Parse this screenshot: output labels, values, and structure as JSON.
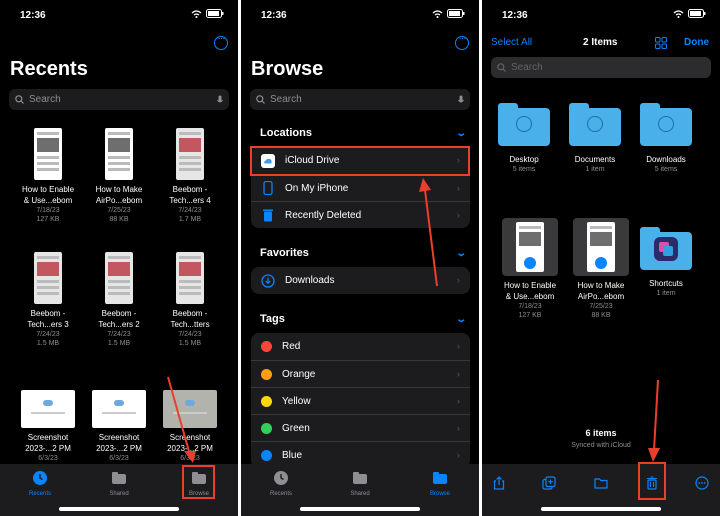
{
  "colors": {
    "accent": "#0a84ff",
    "annotation": "#e8402a",
    "background": "#000000",
    "cell": "#1c1c1e"
  },
  "status": {
    "time": "12:36"
  },
  "recents": {
    "title": "Recents",
    "search_placeholder": "Search",
    "items": [
      {
        "name1": "How to Enable",
        "name2": "& Use...ebom",
        "date": "7/18/23",
        "size": "127 KB"
      },
      {
        "name1": "How to Make",
        "name2": "AirPo...ebom",
        "date": "7/25/23",
        "size": "88 KB"
      },
      {
        "name1": "Beebom -",
        "name2": "Tech...ers 4",
        "date": "7/24/23",
        "size": "1.7 MB"
      },
      {
        "name1": "Beebom -",
        "name2": "Tech...ers 3",
        "date": "7/24/23",
        "size": "1.5 MB"
      },
      {
        "name1": "Beebom -",
        "name2": "Tech...ers 2",
        "date": "7/24/23",
        "size": "1.5 MB"
      },
      {
        "name1": "Beebom -",
        "name2": "Tech...tters",
        "date": "7/24/23",
        "size": "1.5 MB"
      },
      {
        "name1": "Screenshot",
        "name2": "2023-...2 PM",
        "date": "6/3/23",
        "size": ""
      },
      {
        "name1": "Screenshot",
        "name2": "2023-...2 PM",
        "date": "6/3/23",
        "size": ""
      },
      {
        "name1": "Screenshot",
        "name2": "2023-...2 PM",
        "date": "6/3/23",
        "size": ""
      }
    ],
    "tabs": [
      {
        "label": "Recents"
      },
      {
        "label": "Shared"
      },
      {
        "label": "Browse"
      }
    ]
  },
  "browse": {
    "title": "Browse",
    "search_placeholder": "Search",
    "locations_header": "Locations",
    "locations": [
      {
        "label": "iCloud Drive"
      },
      {
        "label": "On My iPhone"
      },
      {
        "label": "Recently Deleted"
      }
    ],
    "favorites_header": "Favorites",
    "favorites": [
      {
        "label": "Downloads"
      }
    ],
    "tags_header": "Tags",
    "tags": [
      {
        "label": "Red",
        "color": "#ff453a"
      },
      {
        "label": "Orange",
        "color": "#ff9f0a"
      },
      {
        "label": "Yellow",
        "color": "#ffd60a"
      },
      {
        "label": "Green",
        "color": "#30d158"
      },
      {
        "label": "Blue",
        "color": "#0a84ff"
      }
    ],
    "tabs": [
      {
        "label": "Recents"
      },
      {
        "label": "Shared"
      },
      {
        "label": "Browse"
      }
    ]
  },
  "icloud": {
    "select_all": "Select All",
    "title": "2 Items",
    "done": "Done",
    "search_placeholder": "Search",
    "folders": [
      {
        "name": "Desktop",
        "meta": "5 items"
      },
      {
        "name": "Documents",
        "meta": "1 item"
      },
      {
        "name": "Downloads",
        "meta": "5 items"
      }
    ],
    "files": [
      {
        "name1": "How to Enable",
        "name2": "& Use...ebom",
        "date": "7/18/23",
        "size": "127 KB"
      },
      {
        "name1": "How to Make",
        "name2": "AirPo...ebom",
        "date": "7/25/23",
        "size": "88 KB"
      },
      {
        "name1": "Shortcuts",
        "name2": "",
        "date": "1 item",
        "size": ""
      }
    ],
    "footer_count": "6 items",
    "footer_sync": "Synced with iCloud"
  }
}
